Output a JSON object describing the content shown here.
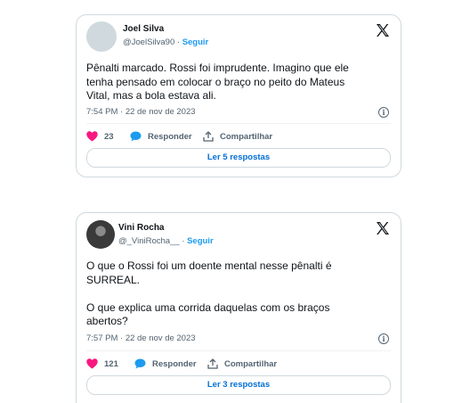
{
  "tweets": [
    {
      "name": "Joel Silva",
      "handle": "@JoelSilva90",
      "dot": "·",
      "follow": "Seguir",
      "text": "Pênalti marcado. Rossi foi imprudente. Imagino que ele\ntenha pensado em colocar o braço no peito do Mateus\nVital, mas a bola estava ali.",
      "timestamp": "7:54 PM · 22 de nov de 2023",
      "likes": "23",
      "reply_label": "Responder",
      "share_label": "Compartilhar",
      "replies_button": "Ler 5 respostas"
    },
    {
      "name": "Vini Rocha",
      "handle": "@_ViniRocha__",
      "dot": "·",
      "follow": "Seguir",
      "text": "O que o Rossi foi um doente mental nesse pênalti é\nSURREAL.\n\nO que explica uma corrida daquelas com os braços\nabertos?",
      "timestamp": "7:57 PM · 22 de nov de 2023",
      "likes": "121",
      "reply_label": "Responder",
      "share_label": "Compartilhar",
      "replies_button": "Ler 3 respostas"
    }
  ],
  "colors": {
    "like": "#f91880",
    "reply": "#1d9bf0",
    "link": "#006fd6",
    "muted": "#536471"
  },
  "icons": [
    "x-logo-icon",
    "heart-icon",
    "reply-bubble-icon",
    "share-icon",
    "info-icon"
  ]
}
